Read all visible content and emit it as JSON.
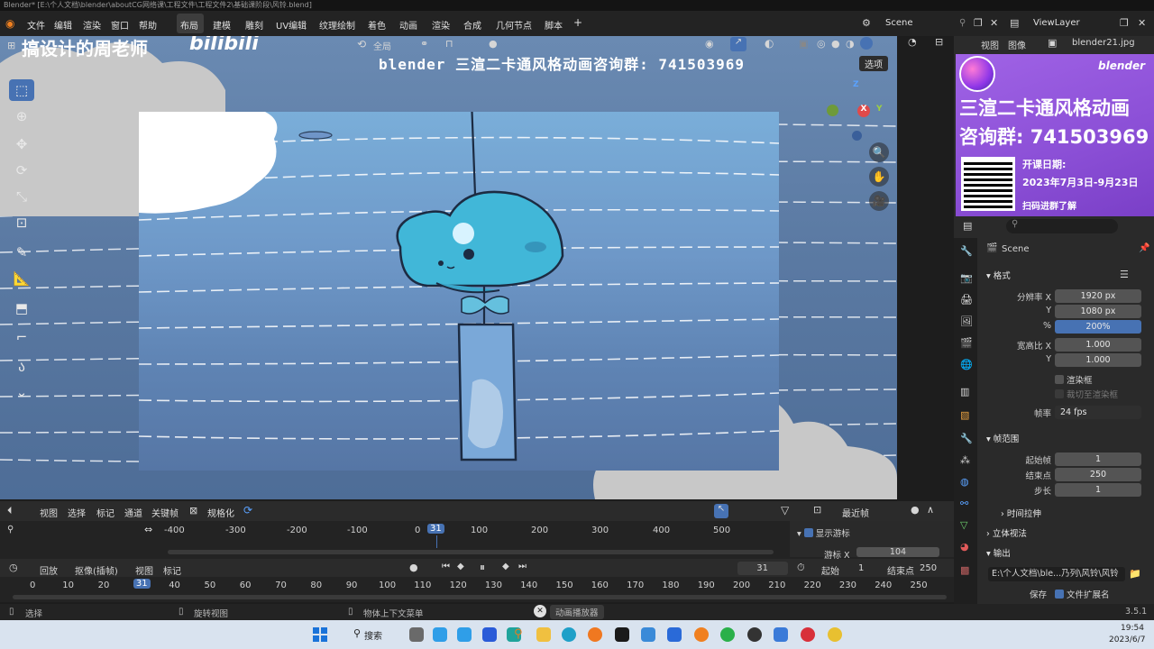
{
  "window": {
    "title": "Blender* [E:\\个人文档\\blender\\aboutCG网络课\\工程文件\\工程文件2\\基础课阶段\\风铃.blend]"
  },
  "menubar": {
    "menus": [
      "文件",
      "编辑",
      "渲染",
      "窗口",
      "帮助"
    ],
    "workspaces": [
      "布局",
      "建模",
      "雕刻",
      "UV编辑",
      "纹理绘制",
      "着色",
      "动画",
      "渲染",
      "合成",
      "几何节点",
      "脚本"
    ],
    "active_workspace": "布局",
    "add_tab": "+",
    "scene": "Scene",
    "view_layer": "ViewLayer"
  },
  "watermark": {
    "channel": "搞设计的周老师",
    "site": "bilibili"
  },
  "viewport": {
    "overlay_text": "blender 三渲二卡通风格动画咨询群: 741503969",
    "global_label": "全局",
    "options_button": "选项",
    "gizmo": {
      "z": "Z",
      "x": "X",
      "y": "Y"
    }
  },
  "image_editor": {
    "menus": [
      "视图",
      "图像"
    ],
    "image_name": "blender21.jpg"
  },
  "ad": {
    "line1": "三渲二卡通风格动画",
    "line2": "咨询群: 741503969",
    "date_title": "开课日期:",
    "date_range": "2023年7月3日-9月23日",
    "scan": "扫码进群了解",
    "brand": "blender"
  },
  "properties": {
    "scene_name": "Scene",
    "format_section": "格式",
    "resolution_x_label": "分辨率 X",
    "resolution_x": "1920 px",
    "resolution_y_label": "Y",
    "resolution_y": "1080 px",
    "percent_label": "%",
    "percent": "200%",
    "aspect_x_label": "宽高比 X",
    "aspect_x": "1.000",
    "aspect_y_label": "Y",
    "aspect_y": "1.000",
    "render_region": "渲染框",
    "crop_to_region": "裁切至渲染框",
    "frame_rate_label": "帧率",
    "frame_rate": "24 fps",
    "frame_range_section": "帧范围",
    "frame_start_label": "起始帧",
    "frame_start": "1",
    "frame_end_label": "结束点",
    "frame_end": "250",
    "frame_step_label": "步长",
    "frame_step": "1",
    "time_stretch": "时间拉伸",
    "stereoscopy": "立体视法",
    "output_section": "输出",
    "output_path": "E:\\个人文档\\ble...乃列\\风铃\\风铃",
    "save_label": "保存",
    "file_ext": "文件扩展名"
  },
  "dopesheet": {
    "menus": [
      "视图",
      "选择",
      "标记",
      "通道",
      "关键帧"
    ],
    "normalize": "规格化",
    "nearest_frame": "最近帧",
    "ruler": [
      "-400",
      "-300",
      "-200",
      "-100",
      "0",
      "31",
      "100",
      "200",
      "300",
      "400",
      "500"
    ],
    "show_cursor": "显示游标",
    "cursor_x_label": "游标 X",
    "cursor_x": "104"
  },
  "timeline": {
    "menus": [
      "回放",
      "抠像(插帧)",
      "视图",
      "标记"
    ],
    "current_frame": "31",
    "start_label": "起始",
    "start": "1",
    "end_label": "结束点",
    "end": "250",
    "ruler": [
      "0",
      "10",
      "20",
      "31",
      "40",
      "50",
      "60",
      "70",
      "80",
      "90",
      "100",
      "110",
      "120",
      "130",
      "140",
      "150",
      "160",
      "170",
      "180",
      "190",
      "200",
      "210",
      "220",
      "230",
      "240",
      "250"
    ]
  },
  "statusbar": {
    "select": "选择",
    "rotate_view": "旋转视图",
    "context_menu": "物体上下文菜单",
    "anim_player": "动画播放器",
    "version": "3.5.1"
  },
  "taskbar": {
    "search": "搜索",
    "time": "19:54",
    "date": "2023/6/7"
  }
}
